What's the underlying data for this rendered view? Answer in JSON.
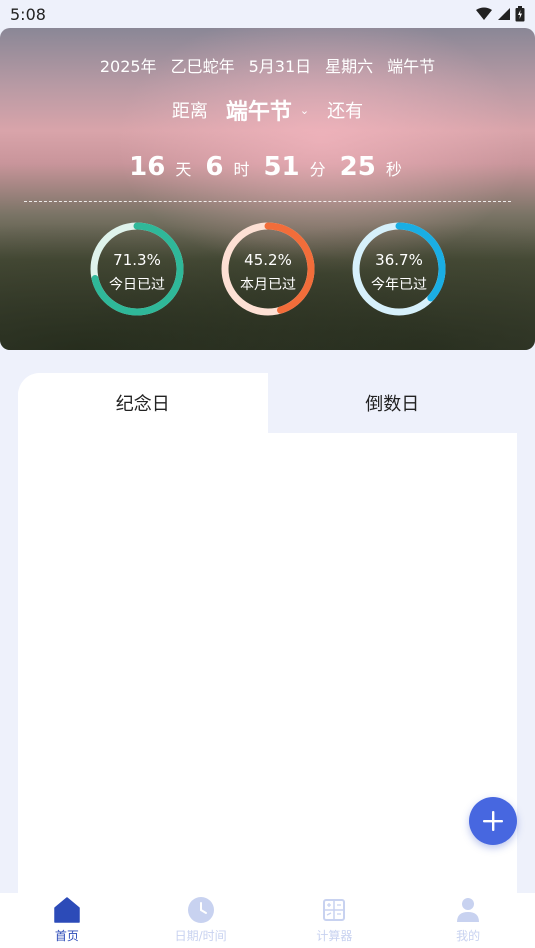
{
  "status_bar": {
    "time": "5:08"
  },
  "hero": {
    "date_line": [
      "2025年",
      "乙巳蛇年",
      "5月31日",
      "星期六",
      "端午节"
    ],
    "prefix": "距离",
    "holiday": "端午节",
    "suffix": "还有",
    "countdown": [
      {
        "value": "16",
        "unit": "天"
      },
      {
        "value": "6",
        "unit": "时"
      },
      {
        "value": "51",
        "unit": "分"
      },
      {
        "value": "25",
        "unit": "秒"
      }
    ],
    "progress": [
      {
        "percent_text": "71.3%",
        "label": "今日已过",
        "fraction": 0.713,
        "color": "#2fb899",
        "track": "#dff3ec"
      },
      {
        "percent_text": "45.2%",
        "label": "本月已过",
        "fraction": 0.452,
        "color": "#f26d3a",
        "track": "#fde0d4"
      },
      {
        "percent_text": "36.7%",
        "label": "今年已过",
        "fraction": 0.367,
        "color": "#1aaee4",
        "track": "#d6f0fb"
      }
    ]
  },
  "tabs": [
    {
      "label": "纪念日",
      "active": true
    },
    {
      "label": "倒数日",
      "active": false
    }
  ],
  "fab": {
    "icon": "plus-icon"
  },
  "bottom_nav": [
    {
      "label": "首页",
      "icon": "home-icon",
      "active": true
    },
    {
      "label": "日期/时间",
      "icon": "clock-icon",
      "active": false
    },
    {
      "label": "计算器",
      "icon": "calculator-icon",
      "active": false
    },
    {
      "label": "我的",
      "icon": "user-icon",
      "active": false
    }
  ],
  "colors": {
    "accent": "#4767e0",
    "nav_active": "#2c4bb8",
    "nav_inactive": "#c8d2f0",
    "background": "#eef1fb"
  }
}
